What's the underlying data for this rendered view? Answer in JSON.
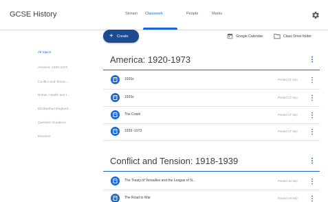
{
  "header": {
    "app_title": "GCSE History",
    "tabs": [
      {
        "label": "Stream",
        "active": false
      },
      {
        "label": "Classwork",
        "active": true
      },
      {
        "label": "People",
        "active": false
      },
      {
        "label": "Marks",
        "active": false
      }
    ],
    "settings_icon": "gear-icon"
  },
  "toolbar": {
    "create_label": "Create",
    "calendar_label": "Google Calendar",
    "drive_label": "Class Drive folder"
  },
  "sidebar": {
    "items": [
      {
        "label": "All topics",
        "active": true
      },
      {
        "label": "America: 1920-1973",
        "active": false
      },
      {
        "label": "Conflict and Tensio...",
        "active": false
      },
      {
        "label": "Britain: Health and t...",
        "active": false
      },
      {
        "label": "Elizabethan England...",
        "active": false
      },
      {
        "label": "Question Guidance",
        "active": false
      },
      {
        "label": "Revision",
        "active": false
      }
    ]
  },
  "topics": [
    {
      "title": "America: 1920-1973",
      "items": [
        {
          "title": "1920s",
          "date": "Posted 17 Sep"
        },
        {
          "title": "1920s",
          "date": "Posted 17 Sep"
        },
        {
          "title": "The Crash",
          "date": "Posted 17 Sep"
        },
        {
          "title": "1939 -1973",
          "date": "Posted 17 Sep"
        }
      ]
    },
    {
      "title": "Conflict and Tension: 1918-1939",
      "items": [
        {
          "title": "The Treaty of Versailles and the League of N...",
          "date": "Posted 18 Sep"
        },
        {
          "title": "The Road to War",
          "date": "Posted 18 Sep"
        }
      ]
    }
  ],
  "colors": {
    "accent": "#1967d2",
    "create_button": "#1a4a90",
    "text": "#3c4043",
    "muted": "#9aa0a6"
  }
}
